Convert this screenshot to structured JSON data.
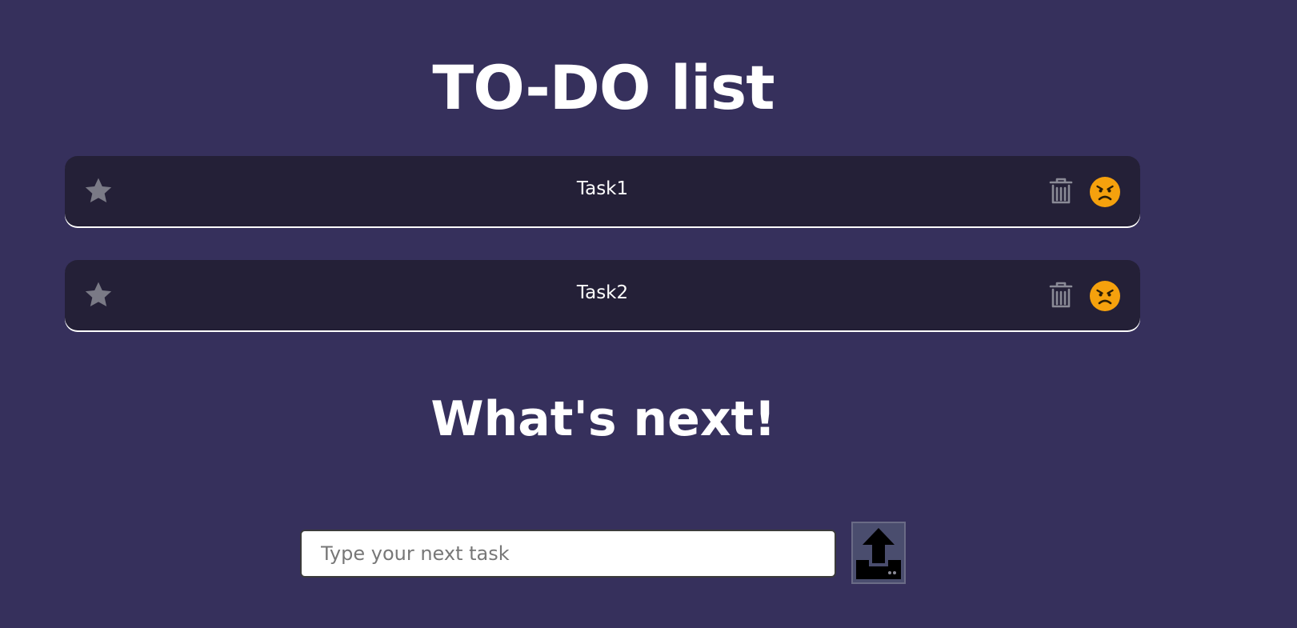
{
  "header": {
    "title": "TO-DO list"
  },
  "tasks": [
    {
      "label": "Task1",
      "star_icon": "star-icon",
      "delete_icon": "trash-icon",
      "mood_icon": "angry-face-icon"
    },
    {
      "label": "Task2",
      "star_icon": "star-icon",
      "delete_icon": "trash-icon",
      "mood_icon": "angry-face-icon"
    }
  ],
  "composer": {
    "title": "What's next!",
    "input_value": "",
    "input_placeholder": "Type your next task",
    "submit_icon": "upload-icon"
  },
  "colors": {
    "background": "#36305c",
    "card": "#242037",
    "star": "#7a7a86",
    "trash": "#8a8a96",
    "mood": "#f5a10d",
    "text": "#ffffff"
  }
}
